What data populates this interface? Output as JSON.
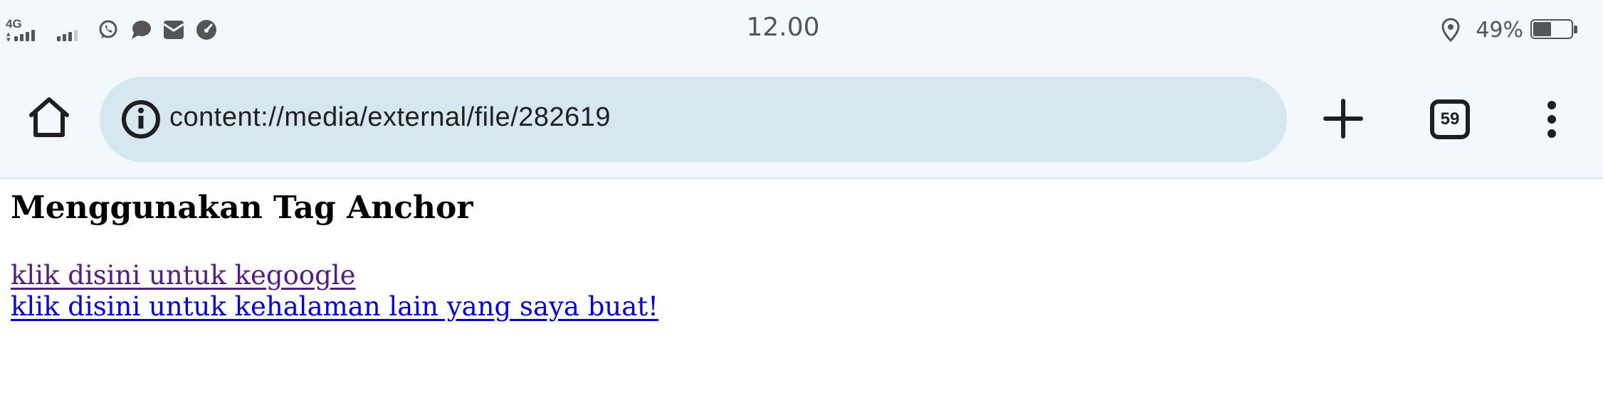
{
  "status_bar": {
    "network_type": "4G",
    "time": "12.00",
    "battery_percent": "49%",
    "battery_level": 0.49,
    "left_icons": [
      "signal-4g-icon",
      "signal-sim2-icon",
      "whatsapp-icon",
      "chat-bubble-icon",
      "mail-icon",
      "speedometer-icon"
    ],
    "right_icons": [
      "location-icon",
      "battery-icon"
    ]
  },
  "toolbar": {
    "url": "content://media/external/file/282619",
    "tab_count": "59",
    "icons": [
      "home-icon",
      "info-icon",
      "plus-icon",
      "tabs-icon",
      "more-vert-icon"
    ]
  },
  "page": {
    "title": "Menggunakan Tag Anchor",
    "links": [
      {
        "text": "klik disini untuk kegoogle",
        "visited": true
      },
      {
        "text": "klik disini untuk kehalaman lain yang saya buat!",
        "visited": false
      }
    ]
  },
  "colors": {
    "status_text": "#555555",
    "toolbar_bg": "#f3f8fc",
    "omnibox_bg": "#d6e7ef",
    "visited_link": "#551a8b",
    "unvisited_link": "#0000ee"
  }
}
